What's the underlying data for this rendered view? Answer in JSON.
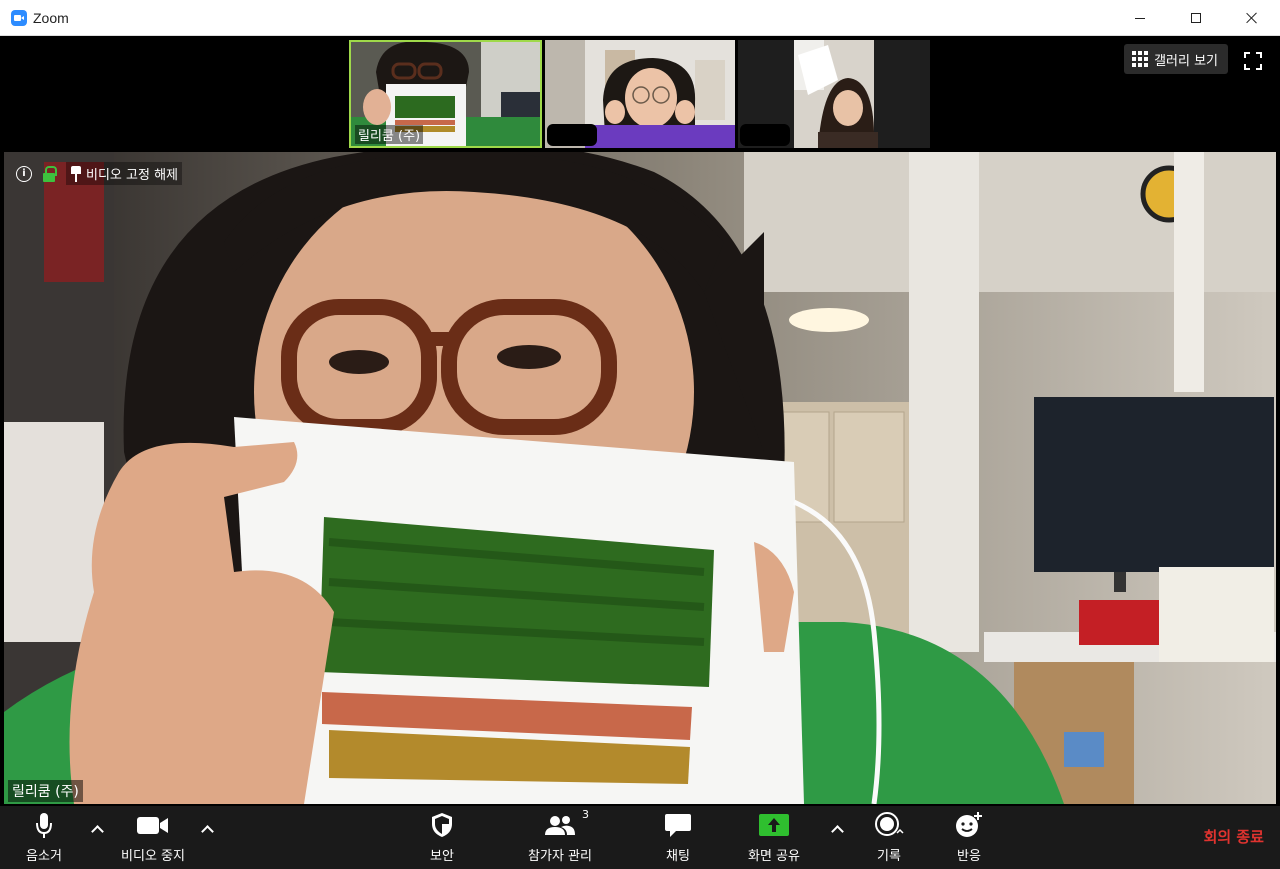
{
  "window": {
    "title": "Zoom"
  },
  "thumbnails": [
    {
      "name": "릴리쿰 (주)"
    },
    {
      "name": ""
    },
    {
      "name": ""
    }
  ],
  "view": {
    "gallery_label": "갤러리 보기"
  },
  "main": {
    "unpin_label": "비디오 고정 해제",
    "speaker_name": "릴리쿰 (주)"
  },
  "toolbar": {
    "mute": "음소거",
    "stop_video": "비디오 중지",
    "security": "보안",
    "participants": "참가자 관리",
    "participants_count": "3",
    "chat": "채팅",
    "share_screen": "화면 공유",
    "record": "기록",
    "reactions": "반응",
    "end_meeting": "회의 종료"
  },
  "colors": {
    "active_speaker_border": "#9fd94a",
    "share_green": "#2fbf2f",
    "end_red": "#e0332f",
    "toolbar_bg": "#1a1a1a"
  }
}
